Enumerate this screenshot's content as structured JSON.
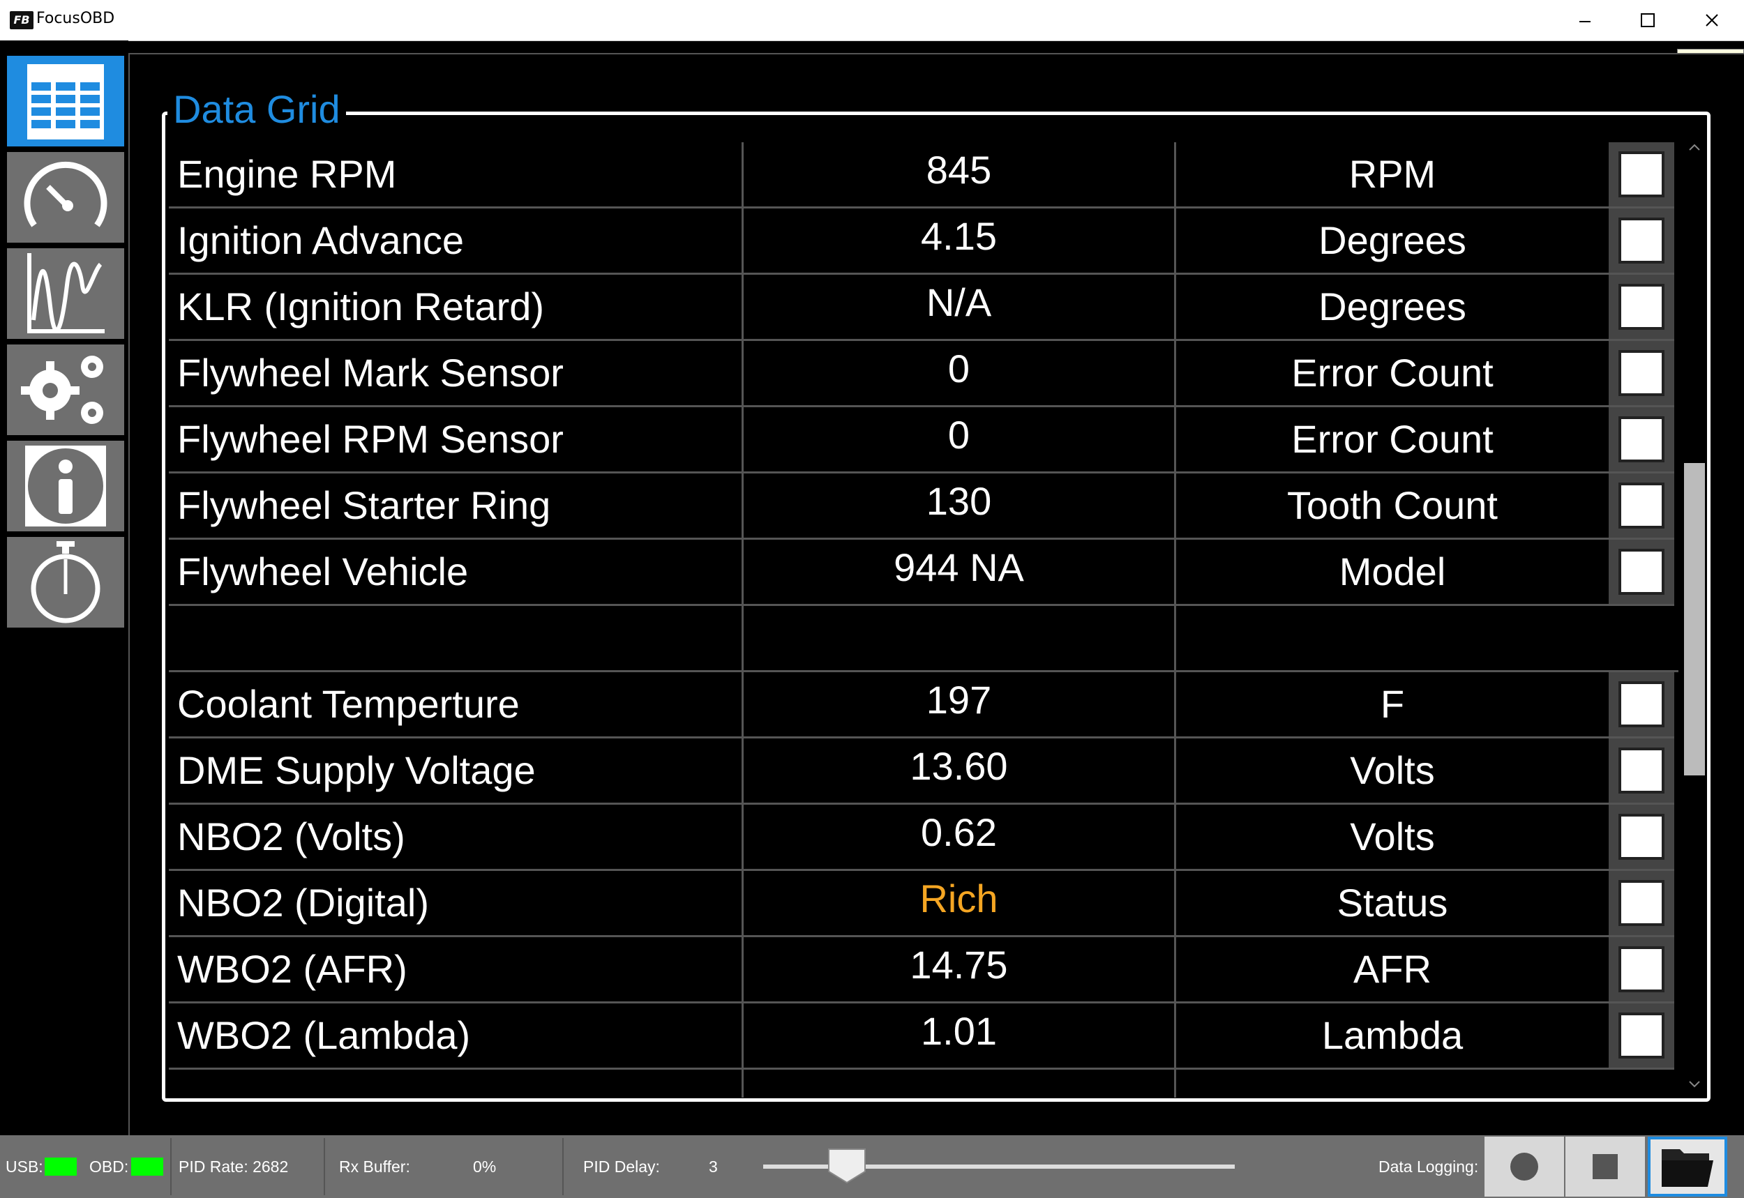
{
  "window": {
    "title": "FocusOBD",
    "logo_text": "FB",
    "tooltip": "Maximize"
  },
  "sidebar": {
    "items": [
      {
        "name": "data-grid",
        "icon": "table-icon",
        "active": true
      },
      {
        "name": "gauges",
        "icon": "gauge-icon",
        "active": false
      },
      {
        "name": "graph",
        "icon": "chart-line-icon",
        "active": false
      },
      {
        "name": "settings",
        "icon": "gears-icon",
        "active": false
      },
      {
        "name": "info",
        "icon": "info-icon",
        "active": false
      },
      {
        "name": "timer",
        "icon": "stopwatch-icon",
        "active": false
      }
    ]
  },
  "main": {
    "title": "Data Grid",
    "rows": [
      {
        "name": "Engine RPM",
        "value": "845",
        "unit": "RPM",
        "checked": false
      },
      {
        "name": "Ignition Advance",
        "value": "4.15",
        "unit": "Degrees",
        "checked": false
      },
      {
        "name": "KLR (Ignition Retard)",
        "value": "N/A",
        "unit": "Degrees",
        "checked": false
      },
      {
        "name": "Flywheel Mark Sensor",
        "value": "0",
        "unit": "Error Count",
        "checked": false
      },
      {
        "name": "Flywheel RPM Sensor",
        "value": "0",
        "unit": "Error Count",
        "checked": false
      },
      {
        "name": "Flywheel Starter Ring",
        "value": "130",
        "unit": "Tooth Count",
        "checked": false
      },
      {
        "name": "Flywheel Vehicle",
        "value": "944 NA",
        "unit": "Model",
        "checked": false
      },
      {
        "name": "",
        "value": "",
        "unit": "",
        "spacer": true
      },
      {
        "name": "Coolant Temperture",
        "value": "197",
        "unit": "F",
        "checked": false
      },
      {
        "name": "DME Supply Voltage",
        "value": "13.60",
        "unit": "Volts",
        "checked": false
      },
      {
        "name": "NBO2 (Volts)",
        "value": "0.62",
        "unit": "Volts",
        "checked": false
      },
      {
        "name": "NBO2 (Digital)",
        "value": "Rich",
        "unit": "Status",
        "checked": false,
        "highlight": true
      },
      {
        "name": "WBO2 (AFR)",
        "value": "14.75",
        "unit": "AFR",
        "checked": false
      },
      {
        "name": "WBO2 (Lambda)",
        "value": "1.01",
        "unit": "Lambda",
        "checked": false
      }
    ],
    "highlight_color": "#f5a623",
    "accent_color": "#1f8ce0"
  },
  "statusbar": {
    "usb_label": "USB:",
    "usb_status_color": "#00ff00",
    "obd_label": "OBD:",
    "obd_status_color": "#00ff00",
    "pid_rate": "PID Rate: 2682",
    "rx_buffer_label": "Rx Buffer:",
    "rx_buffer_value": "0%",
    "pid_delay_label": "PID Delay:",
    "pid_delay_value": "3",
    "data_logging_label": "Data Logging:"
  }
}
